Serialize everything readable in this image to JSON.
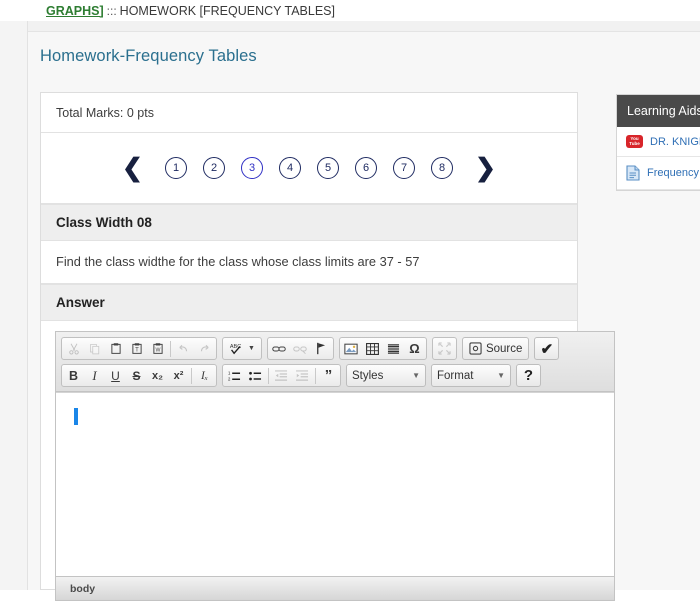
{
  "breadcrumb": {
    "link": "GRAPHS]",
    "separator": ":::",
    "tail": "HOMEWORK [FREQUENCY TABLES]"
  },
  "page": {
    "title": "Homework-Frequency Tables"
  },
  "card": {
    "total_marks": "Total Marks: 0 pts",
    "pager": {
      "prev_icon": "chevron-left-icon",
      "next_icon": "chevron-right-icon",
      "pages": [
        "1",
        "2",
        "3",
        "4",
        "5",
        "6",
        "7",
        "8"
      ],
      "active_page": "3",
      "active_color": "#2f2fc4"
    },
    "question": {
      "heading": "Class Width 08",
      "text": "Find the class widthe for the class whose class limits are 37 - 57"
    },
    "answer": {
      "heading": "Answer"
    }
  },
  "editor": {
    "toolbar_row1": [
      {
        "name": "cut-icon",
        "label": "✂"
      },
      {
        "name": "copy-icon",
        "label": "❐"
      },
      {
        "name": "paste-icon",
        "label": "ὌB"
      },
      {
        "name": "paste-text-icon",
        "label": "T"
      },
      {
        "name": "paste-word-icon",
        "label": "W"
      },
      {
        "name": "undo-icon",
        "label": "↶"
      },
      {
        "name": "redo-icon",
        "label": "↷"
      },
      {
        "name": "spellcheck-icon",
        "label": "ABC"
      },
      {
        "name": "link-icon",
        "label": "ὑ7"
      },
      {
        "name": "unlink-icon",
        "label": "ὑ7"
      },
      {
        "name": "anchor-icon",
        "label": "⚑"
      },
      {
        "name": "image-icon",
        "label": "ὛC"
      },
      {
        "name": "table-icon",
        "label": "⊞"
      },
      {
        "name": "horizontal-rule-icon",
        "label": "☰"
      },
      {
        "name": "special-char-icon",
        "label": "Ω"
      },
      {
        "name": "maximize-icon",
        "label": "⤢"
      }
    ],
    "source_button": "Source",
    "checkmark_button": "✔",
    "toolbar_row2": [
      {
        "name": "bold-icon",
        "label": "B"
      },
      {
        "name": "italic-icon",
        "label": "I"
      },
      {
        "name": "underline-icon",
        "label": "U"
      },
      {
        "name": "strikethrough-icon",
        "label": "S"
      },
      {
        "name": "subscript-icon",
        "label": "x₂"
      },
      {
        "name": "superscript-icon",
        "label": "x²"
      },
      {
        "name": "remove-format-icon",
        "label": "Iₓ"
      },
      {
        "name": "numbered-list-icon",
        "label": "≣"
      },
      {
        "name": "bulleted-list-icon",
        "label": "≣"
      },
      {
        "name": "align-icon",
        "label": "≡"
      },
      {
        "name": "outdent-icon",
        "label": "⇤"
      },
      {
        "name": "indent-icon",
        "label": "⇥"
      },
      {
        "name": "blockquote-icon",
        "label": "”"
      }
    ],
    "styles_dropdown": "Styles",
    "format_dropdown": "Format",
    "help_button": "?",
    "content": "",
    "status_path": "body"
  },
  "learning_aids": {
    "title": "Learning Aids",
    "items": [
      {
        "icon": "youtube-icon",
        "label": "DR. KNIGHT"
      },
      {
        "icon": "document-icon",
        "label": "Frequency T"
      }
    ]
  }
}
